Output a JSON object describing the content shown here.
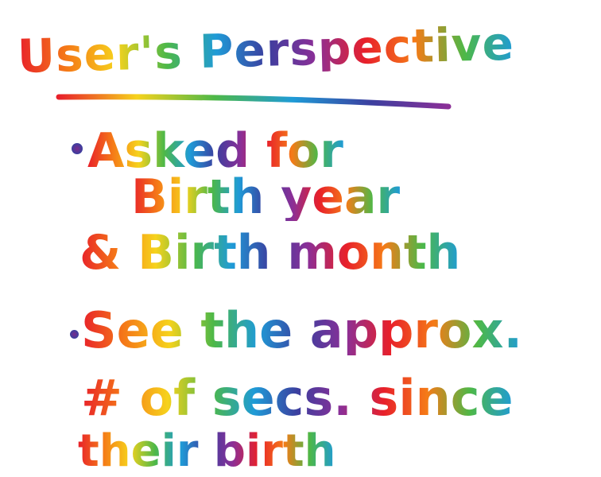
{
  "title": "User's Perspective",
  "bullets": [
    {
      "lines": [
        "Asked for",
        "Birth year",
        "& Birth month"
      ]
    },
    {
      "lines": [
        "See the approx.",
        "# of secs. since",
        "their birth"
      ]
    }
  ],
  "colors": {
    "rainbow": [
      "#e8202a",
      "#f57b17",
      "#f6d21c",
      "#4db848",
      "#1f9bd7",
      "#3b3f9f",
      "#8b2f97"
    ],
    "background": "#ffffff"
  }
}
